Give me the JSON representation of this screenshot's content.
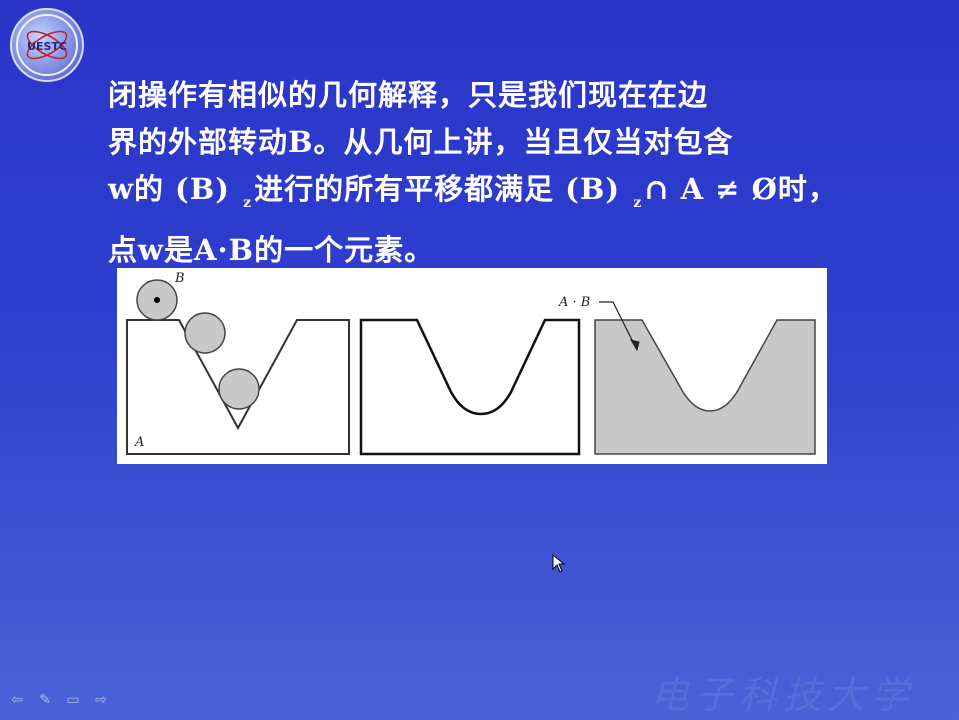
{
  "slide": {
    "logo_text": "UESTC",
    "paragraph_lines": [
      "闭操作有相似的几何解释，只是我们现在在边",
      "界的外部转动B。从几何上讲，当且仅当对包含"
    ],
    "line3": {
      "p1": "w的 (B) ",
      "sub1": "z",
      "p2": "进行的所有平移都满足 (B) ",
      "sub2": "z",
      "p3": "∩ A ≠ Ø时，"
    },
    "line4": "点w是A·B的一个元素。",
    "figure": {
      "label_B": "B",
      "label_A": "A",
      "label_AB": "A · B"
    },
    "footer": "电子科技大学",
    "nav_icons": [
      "arrow-left-icon",
      "pen-icon",
      "menu-icon",
      "arrow-right-icon"
    ]
  }
}
